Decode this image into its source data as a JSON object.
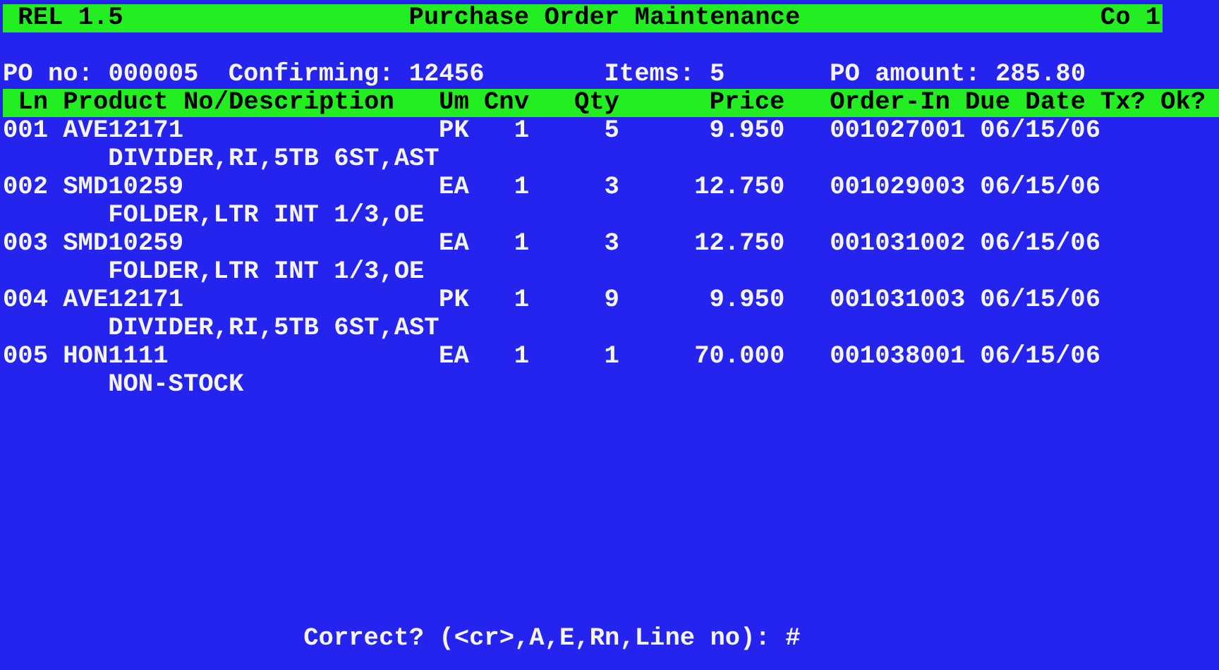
{
  "title_bar": {
    "release": "REL 1.5",
    "title": "Purchase Order Maintenance",
    "company": "Co 1"
  },
  "summary": {
    "po_no": "PO no: 000005",
    "confirming": "Confirming: 12456",
    "items": "Items: 5",
    "po_amount": "PO amount: 285.80"
  },
  "table": {
    "columns": [
      "Ln",
      "Product No/Description",
      "Um",
      "Cnv",
      "Qty",
      "Price",
      "Order-In",
      "Due Date",
      "Tx?",
      "Ok?"
    ],
    "rows": [
      {
        "ln": "001",
        "product": "AVE12171",
        "description": "DIVIDER,RI,5TB 6ST,AST",
        "um": "PK",
        "cnv": "1",
        "qty": "5",
        "price": "9.950",
        "order_in": "001027001",
        "due_date": "06/15/06"
      },
      {
        "ln": "002",
        "product": "SMD10259",
        "description": "FOLDER,LTR INT 1/3,OE",
        "um": "EA",
        "cnv": "1",
        "qty": "3",
        "price": "12.750",
        "order_in": "001029003",
        "due_date": "06/15/06"
      },
      {
        "ln": "003",
        "product": "SMD10259",
        "description": "FOLDER,LTR INT 1/3,OE",
        "um": "EA",
        "cnv": "1",
        "qty": "3",
        "price": "12.750",
        "order_in": "001031002",
        "due_date": "06/15/06"
      },
      {
        "ln": "004",
        "product": "AVE12171",
        "description": "DIVIDER,RI,5TB 6ST,AST",
        "um": "PK",
        "cnv": "1",
        "qty": "9",
        "price": "9.950",
        "order_in": "001031003",
        "due_date": "06/15/06"
      },
      {
        "ln": "005",
        "product": "HON1111",
        "description": "NON-STOCK",
        "um": "EA",
        "cnv": "1",
        "qty": "1",
        "price": "70.000",
        "order_in": "001038001",
        "due_date": "06/15/06"
      }
    ]
  },
  "prompt": {
    "text": "Correct? (<cr>,A,E,Rn,Line no): #"
  }
}
